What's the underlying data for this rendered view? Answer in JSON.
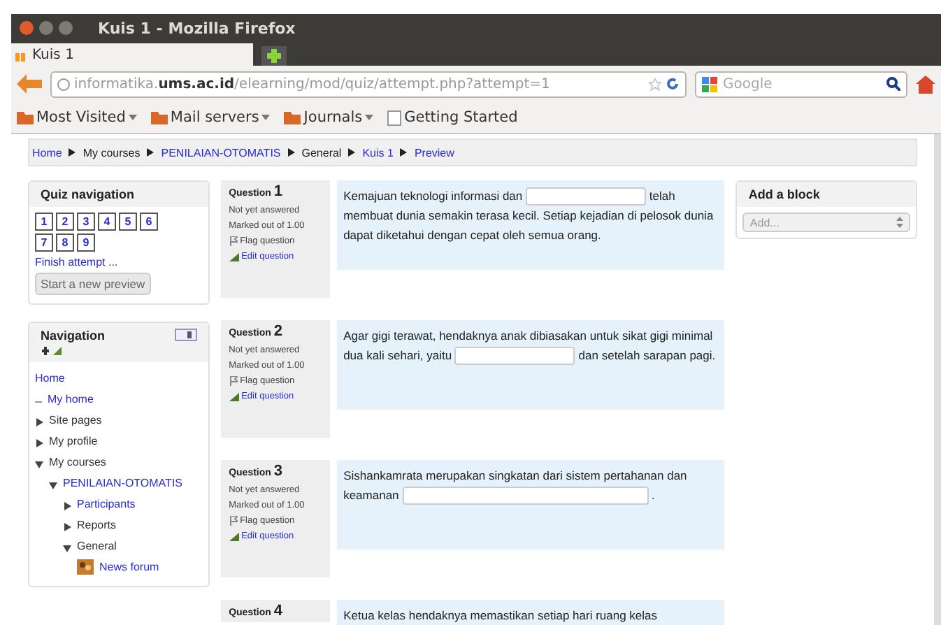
{
  "window": {
    "title": "Kuis 1 - Mozilla Firefox"
  },
  "tabs": [
    {
      "label": "Kuis 1",
      "selected": true
    }
  ],
  "address": {
    "host_prefix": "informatika.",
    "host_domain": "ums.ac.id",
    "path": "/elearning/mod/quiz/attempt.php?attempt=1"
  },
  "search": {
    "placeholder": "Google"
  },
  "bookmarks": [
    {
      "label": "Most Visited",
      "kind": "menu"
    },
    {
      "label": "Mail servers",
      "kind": "menu"
    },
    {
      "label": "Journals",
      "kind": "menu"
    },
    {
      "label": "Getting Started",
      "kind": "page"
    }
  ],
  "breadcrumb": [
    {
      "label": "Home",
      "link": true
    },
    {
      "label": "My courses",
      "link": false
    },
    {
      "label": "PENILAIAN-OTOMATIS",
      "link": true
    },
    {
      "label": "General",
      "link": false
    },
    {
      "label": "Kuis 1",
      "link": true
    },
    {
      "label": "Preview",
      "link": true
    }
  ],
  "quiz_navigation": {
    "title": "Quiz navigation",
    "questions": [
      "1",
      "2",
      "3",
      "4",
      "5",
      "6",
      "7",
      "8",
      "9"
    ],
    "finish": "Finish attempt ...",
    "button": "Start a new preview"
  },
  "navigation": {
    "title": "Navigation",
    "items": [
      {
        "label": "Home",
        "kind": "plain",
        "link": true
      },
      {
        "label": "My home",
        "kind": "leaf",
        "link": true
      },
      {
        "label": "Site pages",
        "kind": "branch",
        "link": false,
        "expanded": false
      },
      {
        "label": "My profile",
        "kind": "branch",
        "link": false,
        "expanded": false
      },
      {
        "label": "My courses",
        "kind": "branch",
        "link": false,
        "expanded": true,
        "children": [
          {
            "label": "PENILAIAN-OTOMATIS",
            "kind": "branch",
            "link": true,
            "expanded": true,
            "children": [
              {
                "label": "Participants",
                "kind": "branch",
                "link": true,
                "expanded": false
              },
              {
                "label": "Reports",
                "kind": "branch",
                "link": false,
                "expanded": false
              },
              {
                "label": "General",
                "kind": "branch",
                "link": false,
                "expanded": true,
                "children": [
                  {
                    "label": "News forum",
                    "kind": "forum",
                    "link": true
                  }
                ]
              }
            ]
          }
        ]
      }
    ]
  },
  "questions": [
    {
      "label": "Question",
      "number": "1",
      "status": "Not yet answered",
      "marks": "Marked out of 1.00",
      "flag": "Flag question",
      "edit": "Edit question",
      "parts": [
        {
          "kind": "text",
          "text": "Kemajuan teknologi informasi dan "
        },
        {
          "kind": "field"
        },
        {
          "kind": "text",
          "text": " telah membuat dunia semakin terasa kecil. Setiap kejadian di pelosok dunia dapat diketahui dengan cepat oleh semua orang."
        }
      ]
    },
    {
      "label": "Question",
      "number": "2",
      "status": "Not yet answered",
      "marks": "Marked out of 1.00",
      "flag": "Flag question",
      "edit": "Edit question",
      "parts": [
        {
          "kind": "text",
          "text": "Agar gigi terawat, hendaknya anak dibiasakan untuk sikat gigi minimal dua kali sehari, yaitu "
        },
        {
          "kind": "field"
        },
        {
          "kind": "text",
          "text": " dan setelah sarapan pagi."
        }
      ]
    },
    {
      "label": "Question",
      "number": "3",
      "status": "Not yet answered",
      "marks": "Marked out of 1.00",
      "flag": "Flag question",
      "edit": "Edit question",
      "parts": [
        {
          "kind": "text",
          "text": "Sishankamrata merupakan singkatan dari sistem pertahanan dan keamanan "
        },
        {
          "kind": "wide_field"
        },
        {
          "kind": "text",
          "text": " ."
        }
      ]
    },
    {
      "label": "Question",
      "number": "4",
      "parts": [
        {
          "kind": "text",
          "text": "Ketua kelas hendaknya memastikan setiap hari ruang kelas"
        }
      ]
    }
  ],
  "add_block": {
    "title": "Add a block",
    "select": "Add..."
  }
}
